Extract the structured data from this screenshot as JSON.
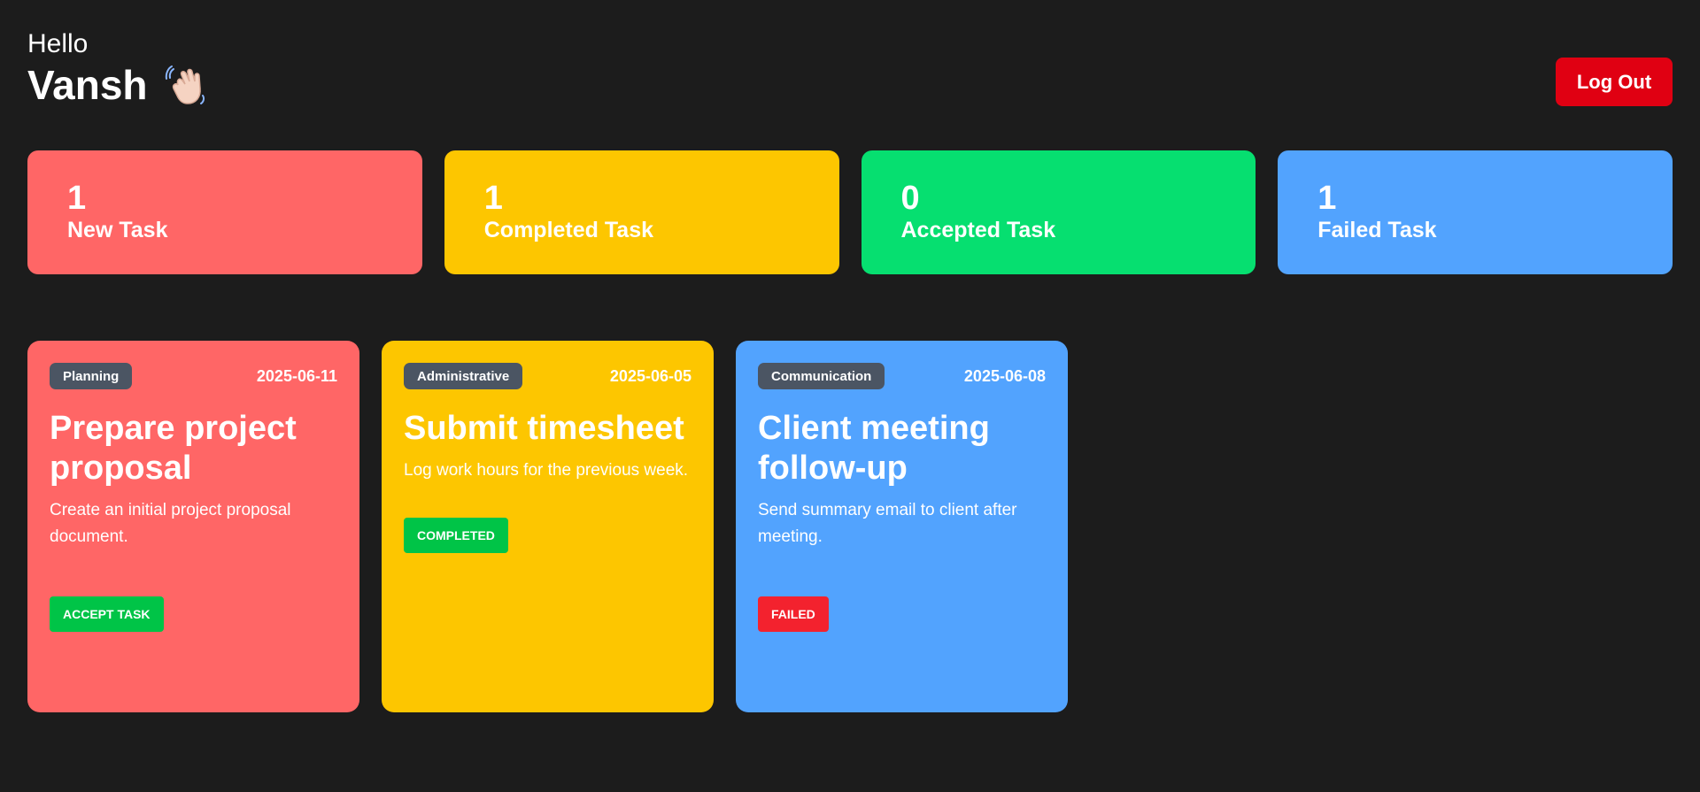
{
  "header": {
    "hello_text": "Hello",
    "user_name": "Vansh",
    "wave_icon": "waving-hand-icon",
    "logout_label": "Log Out"
  },
  "colors": {
    "background": "#1c1c1c",
    "red": "#ff6666",
    "yellow": "#fdc600",
    "green": "#06df70",
    "blue": "#52a3fe",
    "logout": "#e00012",
    "badge": "#4b5563",
    "action_green": "#00c447",
    "action_red": "#f3222e"
  },
  "stats": [
    {
      "count": "1",
      "label": "New Task",
      "color": "#ff6666"
    },
    {
      "count": "1",
      "label": "Completed Task",
      "color": "#fdc600"
    },
    {
      "count": "0",
      "label": "Accepted Task",
      "color": "#06df70"
    },
    {
      "count": "1",
      "label": "Failed Task",
      "color": "#52a3fe"
    }
  ],
  "tasks": [
    {
      "category": "Planning",
      "date": "2025-06-11",
      "title": "Prepare project proposal",
      "description": "Create an initial project proposal document.",
      "action": "ACCEPT TASK",
      "color": "#ff6666"
    },
    {
      "category": "Administrative",
      "date": "2025-06-05",
      "title": "Submit timesheet",
      "description": "Log work hours for the previous week.",
      "action": "COMPLETED",
      "color": "#fdc600"
    },
    {
      "category": "Communication",
      "date": "2025-06-08",
      "title": "Client meeting follow-up",
      "description": "Send summary email to client after meeting.",
      "action": "FAILED",
      "color": "#52a3fe"
    }
  ]
}
